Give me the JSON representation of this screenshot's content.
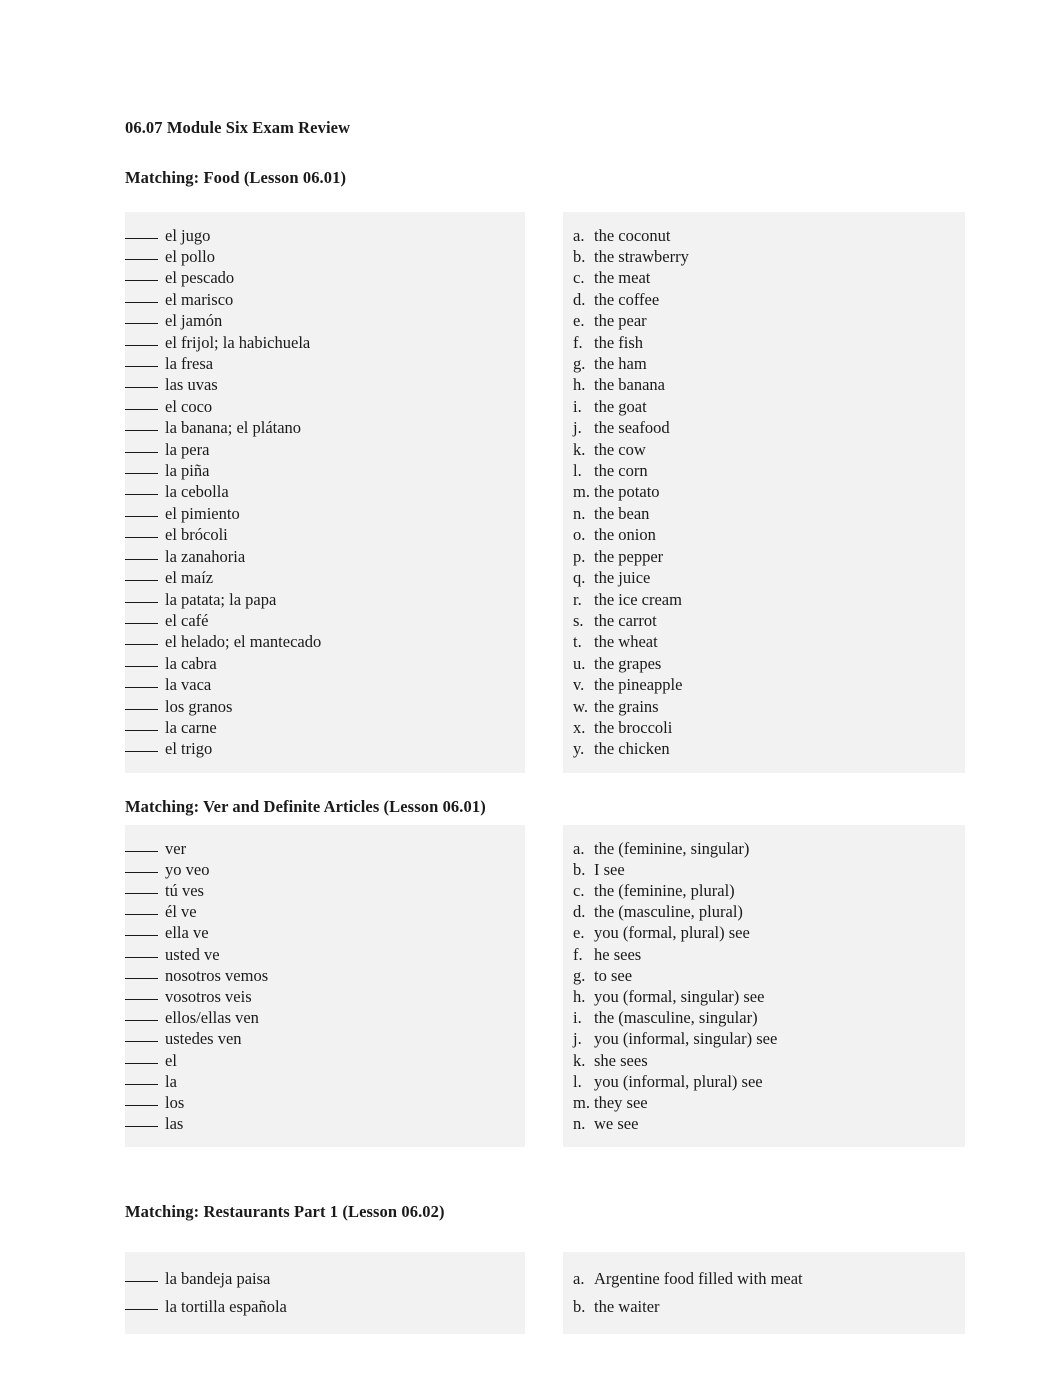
{
  "document": {
    "title": "06.07 Module Six Exam Review"
  },
  "sections": [
    {
      "heading": "Matching: Food (Lesson 06.01)",
      "terms": [
        "el jugo",
        "el pollo",
        "el pescado",
        "el marisco",
        "el jamón",
        "el frijol; la habichuela",
        "la fresa",
        "las uvas",
        "el coco",
        "la banana; el plátano",
        "la pera",
        "la piña",
        "la cebolla",
        "el pimiento",
        "el brócoli",
        "la zanahoria",
        "el maíz",
        "la patata; la papa",
        "el café",
        "el helado; el mantecado",
        "la cabra",
        "la vaca",
        "los granos",
        "la carne",
        "el trigo"
      ],
      "answers": [
        {
          "marker": "a.",
          "text": "the coconut"
        },
        {
          "marker": "b.",
          "text": "the strawberry"
        },
        {
          "marker": "c.",
          "text": "the meat"
        },
        {
          "marker": "d.",
          "text": "the coffee"
        },
        {
          "marker": "e.",
          "text": "the pear"
        },
        {
          "marker": "f.",
          "text": "the fish"
        },
        {
          "marker": "g.",
          "text": "the ham"
        },
        {
          "marker": "h.",
          "text": "the banana"
        },
        {
          "marker": "i.",
          "text": "the goat"
        },
        {
          "marker": "j.",
          "text": "the seafood"
        },
        {
          "marker": "k.",
          "text": "the cow"
        },
        {
          "marker": "l.",
          "text": "the corn"
        },
        {
          "marker": "m.",
          "text": "the potato"
        },
        {
          "marker": "n.",
          "text": "the bean"
        },
        {
          "marker": "o.",
          "text": "the onion"
        },
        {
          "marker": "p.",
          "text": "the pepper"
        },
        {
          "marker": "q.",
          "text": "the juice"
        },
        {
          "marker": "r.",
          "text": "the ice cream"
        },
        {
          "marker": "s.",
          "text": "the carrot"
        },
        {
          "marker": "t.",
          "text": "the wheat"
        },
        {
          "marker": "u.",
          "text": "the grapes"
        },
        {
          "marker": "v.",
          "text": "the pineapple"
        },
        {
          "marker": "w.",
          "text": "the grains"
        },
        {
          "marker": "x.",
          "text": "the broccoli"
        },
        {
          "marker": "y.",
          "text": "the chicken"
        }
      ]
    },
    {
      "heading": "Matching: Ver and Definite Articles (Lesson 06.01)",
      "terms": [
        "ver",
        "yo veo",
        "tú ves",
        "él ve",
        "ella ve",
        "usted ve",
        "nosotros vemos",
        "vosotros veis",
        "ellos/ellas ven",
        "ustedes ven",
        "el",
        "la",
        "los",
        "las"
      ],
      "answers": [
        {
          "marker": "a.",
          "text": "the (feminine, singular)"
        },
        {
          "marker": "b.",
          "text": "I see"
        },
        {
          "marker": "c.",
          "text": "the (feminine, plural)"
        },
        {
          "marker": "d.",
          "text": "the (masculine, plural)"
        },
        {
          "marker": "e.",
          "text": "you (formal, plural) see"
        },
        {
          "marker": "f.",
          "text": "he sees"
        },
        {
          "marker": "g.",
          "text": "to see"
        },
        {
          "marker": "h.",
          "text": "you (formal, singular) see"
        },
        {
          "marker": "i.",
          "text": "the (masculine, singular)"
        },
        {
          "marker": "j.",
          "text": "you (informal, singular) see"
        },
        {
          "marker": "k.",
          "text": "she sees"
        },
        {
          "marker": "l.",
          "text": "you (informal, plural) see"
        },
        {
          "marker": "m.",
          "text": "they see"
        },
        {
          "marker": "n.",
          "text": "we see"
        }
      ]
    },
    {
      "heading": "Matching: Restaurants Part 1 (Lesson 06.02)",
      "terms": [
        "la bandeja paisa",
        "la tortilla española"
      ],
      "answers": [
        {
          "marker": "a.",
          "text": "Argentine food filled with meat"
        },
        {
          "marker": "b.",
          "text": "the waiter"
        }
      ]
    }
  ]
}
